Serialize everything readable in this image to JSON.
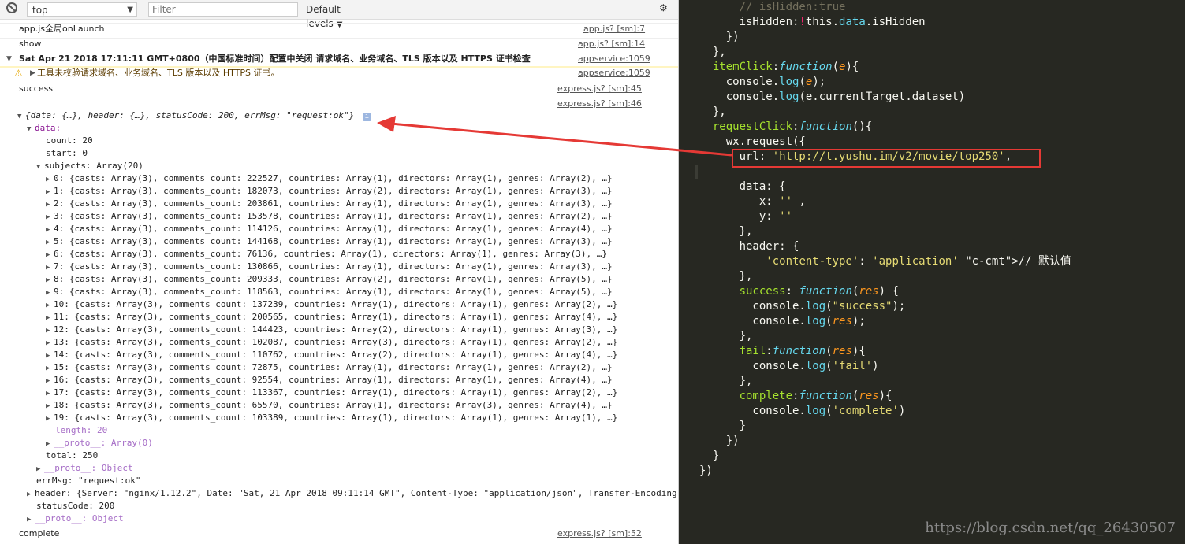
{
  "toolbar": {
    "context": "top",
    "filter_placeholder": "Filter",
    "levels": "Default levels"
  },
  "logs": [
    {
      "text": "app.js全局onLaunch",
      "src": "app.js? [sm]:7"
    },
    {
      "text": "show",
      "src": "app.js? [sm]:14"
    },
    {
      "text": "Sat Apr 21 2018 17:11:11 GMT+0800（中国标准时间）配置中关闭 请求域名、业务域名、TLS 版本以及 HTTPS 证书检查",
      "src": "appservice:1059"
    },
    {
      "text": "工具未校验请求域名、业务域名、TLS 版本以及 HTTPS 证书。",
      "src": "appservice:1059"
    },
    {
      "text": "success",
      "src": "express.js? [sm]:45"
    },
    {
      "text": "",
      "src": "express.js? [sm]:46"
    },
    {
      "text": "complete",
      "src": "express.js? [sm]:52"
    }
  ],
  "tree": {
    "root_preview": "{data: {…}, header: {…}, statusCode: 200, errMsg: \"request:ok\"}",
    "data_key": "data:",
    "count": "count: 20",
    "start": "start: 0",
    "subjects": "subjects: Array(20)",
    "items": [
      "0: {casts: Array(3), comments_count: 222527, countries: Array(1), directors: Array(1), genres: Array(2), …}",
      "1: {casts: Array(3), comments_count: 182073, countries: Array(2), directors: Array(1), genres: Array(3), …}",
      "2: {casts: Array(3), comments_count: 203861, countries: Array(1), directors: Array(1), genres: Array(3), …}",
      "3: {casts: Array(3), comments_count: 153578, countries: Array(1), directors: Array(1), genres: Array(2), …}",
      "4: {casts: Array(3), comments_count: 114126, countries: Array(1), directors: Array(1), genres: Array(4), …}",
      "5: {casts: Array(3), comments_count: 144168, countries: Array(1), directors: Array(1), genres: Array(3), …}",
      "6: {casts: Array(3), comments_count: 76136, countries: Array(1), directors: Array(1), genres: Array(3), …}",
      "7: {casts: Array(3), comments_count: 130866, countries: Array(1), directors: Array(1), genres: Array(3), …}",
      "8: {casts: Array(3), comments_count: 209333, countries: Array(2), directors: Array(1), genres: Array(5), …}",
      "9: {casts: Array(3), comments_count: 118563, countries: Array(1), directors: Array(1), genres: Array(5), …}",
      "10: {casts: Array(3), comments_count: 137239, countries: Array(1), directors: Array(1), genres: Array(2), …}",
      "11: {casts: Array(3), comments_count: 200565, countries: Array(1), directors: Array(1), genres: Array(4), …}",
      "12: {casts: Array(3), comments_count: 144423, countries: Array(2), directors: Array(1), genres: Array(3), …}",
      "13: {casts: Array(3), comments_count: 102087, countries: Array(3), directors: Array(1), genres: Array(2), …}",
      "14: {casts: Array(3), comments_count: 110762, countries: Array(2), directors: Array(1), genres: Array(4), …}",
      "15: {casts: Array(3), comments_count: 72875, countries: Array(1), directors: Array(1), genres: Array(2), …}",
      "16: {casts: Array(3), comments_count: 92554, countries: Array(1), directors: Array(1), genres: Array(4), …}",
      "17: {casts: Array(3), comments_count: 113367, countries: Array(1), directors: Array(1), genres: Array(2), …}",
      "18: {casts: Array(3), comments_count: 65570, countries: Array(1), directors: Array(3), genres: Array(4), …}",
      "19: {casts: Array(3), comments_count: 103389, countries: Array(1), directors: Array(1), genres: Array(1), …}"
    ],
    "length": "length: 20",
    "proto_array": "__proto__: Array(0)",
    "total": "total: 250",
    "proto_object": "__proto__: Object",
    "errmsg": "errMsg: \"request:ok\"",
    "header": "header: {Server: \"nginx/1.12.2\", Date: \"Sat, 21 Apr 2018 09:11:14 GMT\", Content-Type: \"application/json\", Transfer-Encoding:",
    "status": "statusCode: 200",
    "proto_root": "__proto__: Object"
  },
  "code": [
    "      // isHidden:true",
    "      isHidden:!this.data.isHidden",
    "    })",
    "  },",
    "  itemClick:function(e){",
    "    console.log(e);",
    "    console.log(e.currentTarget.dataset)",
    "  },",
    "  requestClick:function(){",
    "    wx.request({",
    "      url: 'http://t.yushu.im/v2/movie/top250',",
    "",
    "      data: {",
    "         x: '' ,",
    "         y: ''",
    "      },",
    "      header: {",
    "          'content-type': 'application' // 默认值",
    "      },",
    "      success: function(res) {",
    "        console.log(\"success\");",
    "        console.log(res);",
    "      },",
    "      fail:function(res){",
    "        console.log('fail')",
    "      },",
    "      complete:function(res){",
    "        console.log('complete')",
    "      }",
    "    })",
    "  }",
    "})"
  ],
  "watermark": "https://blog.csdn.net/qq_26430507",
  "colors": {
    "annotation": "#e53935",
    "editor_bg": "#272822"
  }
}
